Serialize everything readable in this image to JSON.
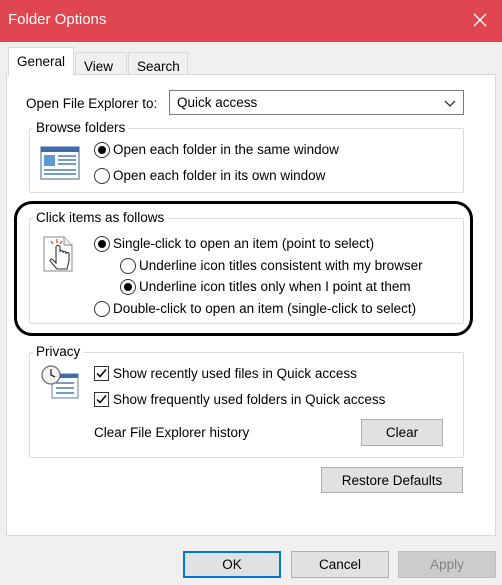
{
  "window": {
    "title": "Folder Options",
    "accent_color": "#e0464f"
  },
  "tabs": [
    {
      "label": "General",
      "active": true
    },
    {
      "label": "View",
      "active": false
    },
    {
      "label": "Search",
      "active": false
    }
  ],
  "open_explorer": {
    "label": "Open File Explorer to:",
    "value": "Quick access"
  },
  "browse_folders": {
    "legend": "Browse folders",
    "options": [
      {
        "label": "Open each folder in the same window",
        "checked": true
      },
      {
        "label": "Open each folder in its own window",
        "checked": false
      }
    ]
  },
  "click_items": {
    "legend": "Click items as follows",
    "options": [
      {
        "label": "Single-click to open an item (point to select)",
        "checked": true
      },
      {
        "label": "Underline icon titles consistent with my browser",
        "checked": false
      },
      {
        "label": "Underline icon titles only when I point at them",
        "checked": true
      },
      {
        "label": "Double-click to open an item (single-click to select)",
        "checked": false
      }
    ]
  },
  "privacy": {
    "legend": "Privacy",
    "checkboxes": [
      {
        "label": "Show recently used files in Quick access",
        "checked": true
      },
      {
        "label": "Show frequently used folders in Quick access",
        "checked": true
      }
    ],
    "clear_history_label": "Clear File Explorer history",
    "clear_button": "Clear"
  },
  "buttons": {
    "restore_defaults": "Restore Defaults",
    "ok": "OK",
    "cancel": "Cancel",
    "apply": "Apply"
  }
}
